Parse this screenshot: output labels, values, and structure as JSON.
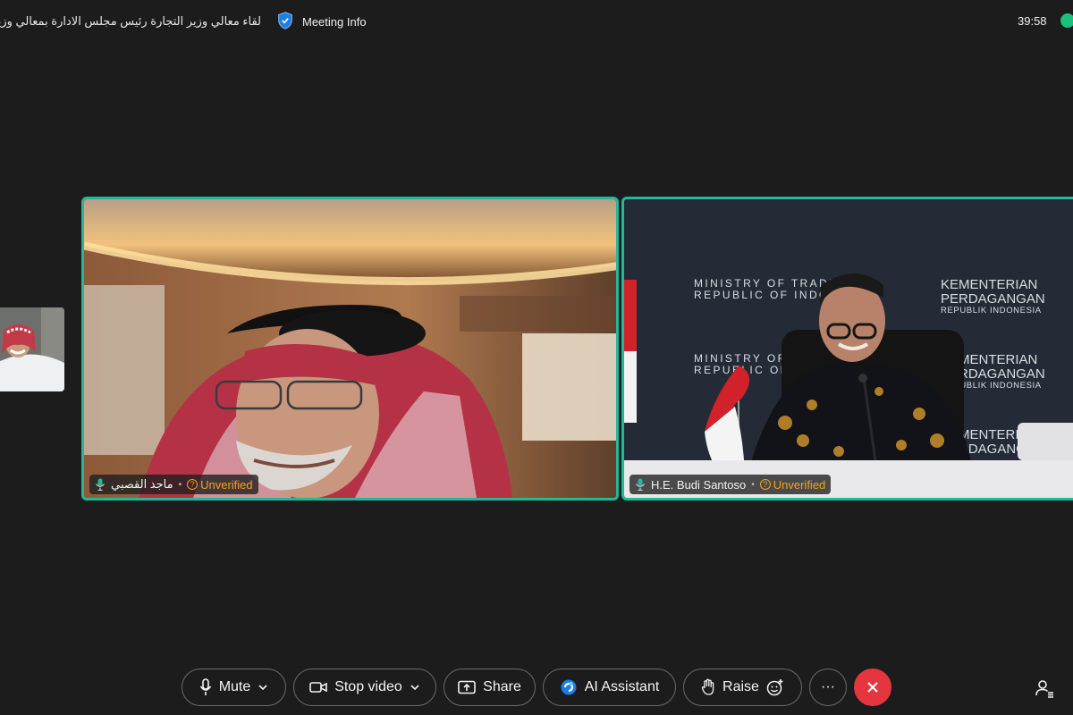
{
  "header": {
    "meeting_title": "لقاء معالي وزير التجارة رئيس مجلس الادارة بمعالي وزير التجارة الإندونيسي",
    "meeting_info_label": "Meeting Info",
    "timer": "39:58"
  },
  "participants": [
    {
      "name": "ماجد القصبي",
      "status": "Unverified"
    },
    {
      "name": "H.E. Budi Santoso",
      "status": "Unverified"
    }
  ],
  "backdrop": {
    "line1": "MINISTRY OF TRADE",
    "line2": "REPUBLIC OF INDONESIA",
    "right1": "KEMENTERIAN",
    "right2": "PERDAGANGAN",
    "right3": "REPUBLIK INDONESIA"
  },
  "toolbar": {
    "mute_label": "Mute",
    "stop_video_label": "Stop video",
    "share_label": "Share",
    "ai_assistant_label": "AI Assistant",
    "raise_label": "Raise",
    "more_label": "···"
  },
  "colors": {
    "active_border": "#24b79c",
    "leave": "#e5363f",
    "unverified": "#f2a21b",
    "network": "#19c37d"
  }
}
